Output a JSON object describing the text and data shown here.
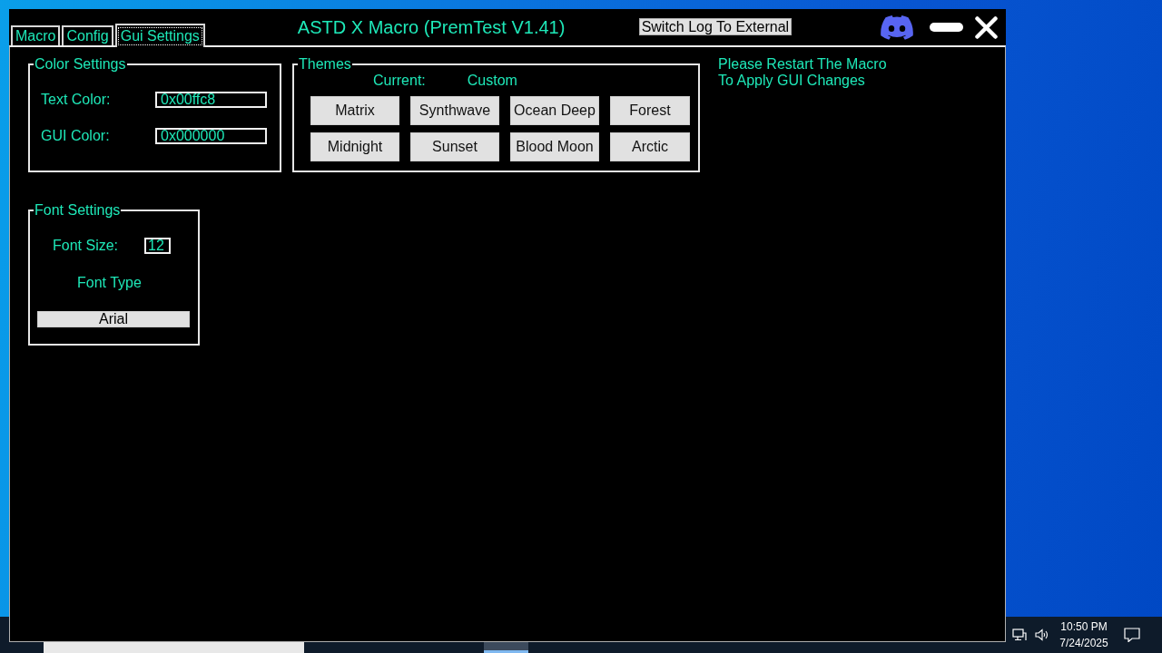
{
  "window": {
    "title": "ASTD X Macro (PremTest V1.41)",
    "log_button": "Switch Log To External"
  },
  "tabs": [
    {
      "label": "Macro",
      "selected": false
    },
    {
      "label": "Config",
      "selected": false
    },
    {
      "label": "Gui Settings",
      "selected": true
    }
  ],
  "color_settings": {
    "title": "Color Settings",
    "fields": [
      {
        "label": "Text Color:",
        "value": "0x00ffc8"
      },
      {
        "label": "GUI Color:",
        "value": "0x000000"
      }
    ]
  },
  "themes": {
    "title": "Themes",
    "current_label": "Current:",
    "current_value": "Custom",
    "buttons": [
      "Matrix",
      "Synthwave",
      "Ocean Deep",
      "Forest",
      "Midnight",
      "Sunset",
      "Blood Moon",
      "Arctic"
    ]
  },
  "notice": "Please Restart The Macro To Apply GUI Changes",
  "font_settings": {
    "title": "Font Settings",
    "size_label": "Font Size:",
    "size_value": "12",
    "type_label": "Font Type",
    "font": "Arial"
  },
  "taskbar": {
    "time": "10:50 PM",
    "date": "7/24/2025"
  }
}
